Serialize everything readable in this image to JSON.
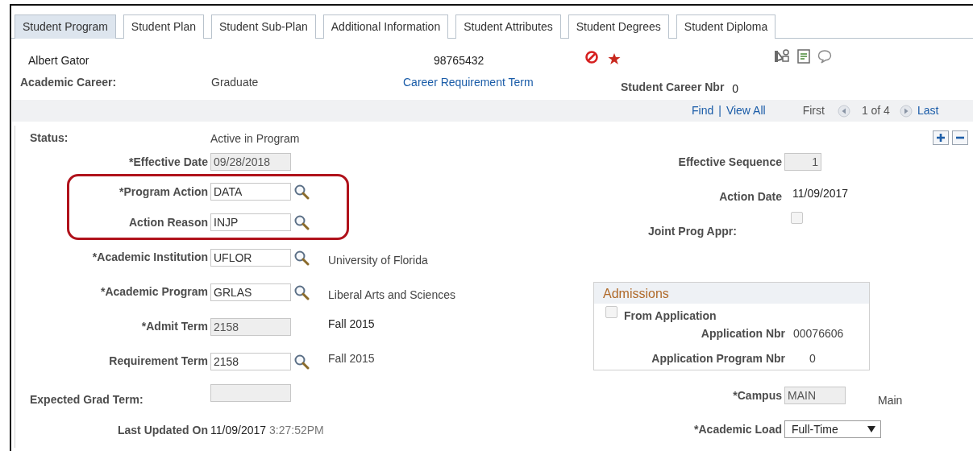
{
  "tabs": [
    {
      "label": "Student Program",
      "selected": true
    },
    {
      "label": "Student Plan",
      "selected": false
    },
    {
      "label": "Student Sub-Plan",
      "selected": false
    },
    {
      "label": "Additional Information",
      "selected": false
    },
    {
      "label": "Student Attributes",
      "selected": false
    },
    {
      "label": "Student Degrees",
      "selected": false
    },
    {
      "label": "Student Diploma",
      "selected": false
    }
  ],
  "header": {
    "name": "Albert Gator",
    "id": "98765432",
    "career_label": "Academic Career:",
    "career_value": "Graduate",
    "career_link": "Career Requirement Term",
    "career_nbr_label": "Student Career Nbr",
    "career_nbr": "0"
  },
  "nav": {
    "find": "Find",
    "separator": "|",
    "view_all": "View All",
    "first": "First",
    "count": "1 of 4",
    "last": "Last"
  },
  "left_fields": [
    {
      "kind": "left-text",
      "label": "Status:",
      "value": "Active in Program",
      "highlighted": false
    },
    {
      "kind": "input",
      "label": "*Effective Date",
      "value": "09/28/2018",
      "disabled": true,
      "lookup": false,
      "highlighted": false
    },
    {
      "kind": "input",
      "label": "*Program Action",
      "value": "DATA",
      "disabled": false,
      "lookup": true,
      "highlighted": true
    },
    {
      "kind": "input",
      "label": "Action Reason",
      "value": "INJP",
      "disabled": false,
      "lookup": true,
      "highlighted": true
    },
    {
      "kind": "input",
      "label": "*Academic Institution",
      "value": "UFLOR",
      "disabled": false,
      "lookup": true,
      "description": "University of Florida",
      "highlighted": false
    },
    {
      "kind": "input",
      "label": "*Academic Program",
      "value": "GRLAS",
      "disabled": false,
      "lookup": true,
      "description": "Liberal Arts and Sciences",
      "highlighted": false
    },
    {
      "kind": "input",
      "label": "*Admit Term",
      "value": "2158",
      "disabled": true,
      "lookup": false,
      "description": "Fall 2015",
      "highlighted": false
    },
    {
      "kind": "input",
      "label": "Requirement Term",
      "value": "2158",
      "disabled": false,
      "lookup": true,
      "description": "Fall 2015",
      "highlighted": false
    },
    {
      "kind": "left-input",
      "label": "Expected Grad Term:",
      "disabled": true,
      "highlighted": false
    },
    {
      "kind": "updated",
      "label": "Last Updated On",
      "value": "11/09/2017",
      "time": "3:27:52PM",
      "highlighted": false
    }
  ],
  "right_fields": [
    {
      "kind": "input",
      "label": "Effective Sequence",
      "value": "1",
      "disabled": true
    },
    {
      "kind": "text",
      "label": "Action Date",
      "value": "11/09/2017"
    },
    {
      "kind": "checkbox",
      "label": "Joint Prog Appr:",
      "checked": false
    }
  ],
  "admissions": {
    "title": "Admissions",
    "from_application": {
      "label": "From Application",
      "checked": false
    },
    "rows": [
      {
        "label": "Application Nbr",
        "value": "00076606"
      },
      {
        "label": "Application Program Nbr",
        "value": "0"
      }
    ]
  },
  "bottom_fields": [
    {
      "kind": "input",
      "label": "*Campus",
      "value": "MAIN",
      "disabled": true,
      "description": "Main"
    },
    {
      "kind": "select",
      "label": "*Academic Load",
      "value": "Full-Time"
    }
  ]
}
